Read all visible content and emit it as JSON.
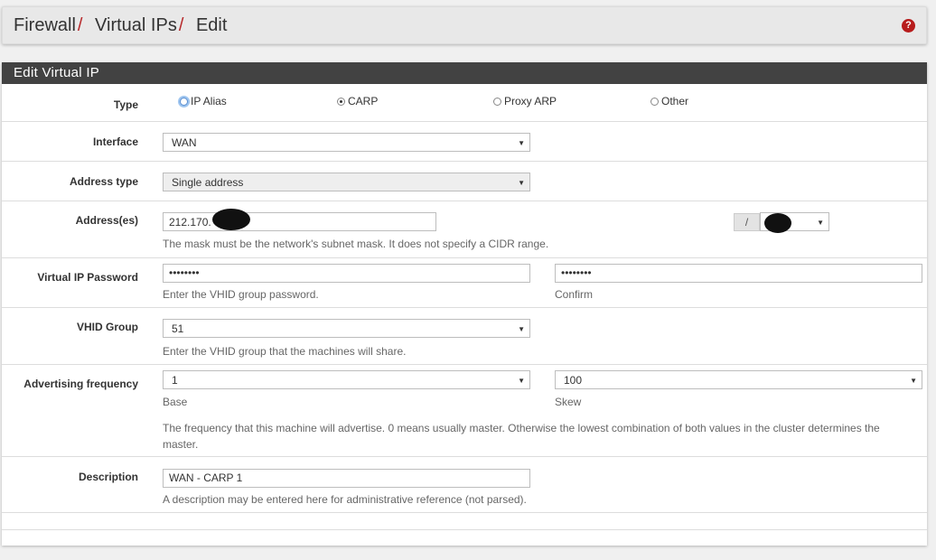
{
  "breadcrumb": {
    "items": [
      "Firewall",
      "Virtual IPs",
      "Edit"
    ],
    "separator": "/"
  },
  "help_icon": "?",
  "panel": {
    "title": "Edit Virtual IP"
  },
  "type": {
    "label": "Type",
    "options": [
      "IP Alias",
      "CARP",
      "Proxy ARP",
      "Other"
    ],
    "selected": "CARP"
  },
  "interface": {
    "label": "Interface",
    "value": "WAN"
  },
  "address_type": {
    "label": "Address type",
    "value": "Single address"
  },
  "addresses": {
    "label": "Address(es)",
    "value": "212.170.",
    "mask_separator": "/",
    "help": "The mask must be the network's subnet mask. It does not specify a CIDR range."
  },
  "password": {
    "label": "Virtual IP Password",
    "value": "••••••••",
    "confirm_value": "••••••••",
    "help": "Enter the VHID group password.",
    "confirm_help": "Confirm"
  },
  "vhid": {
    "label": "VHID Group",
    "value": "51",
    "help": "Enter the VHID group that the machines will share."
  },
  "advertising": {
    "label": "Advertising frequency",
    "base_value": "1",
    "skew_value": "100",
    "base_help": "Base",
    "skew_help": "Skew",
    "help_line1": "The frequency that this machine will advertise. 0 means usually master. Otherwise the lowest combination of both values in the cluster determines the",
    "help_line2": "master."
  },
  "description": {
    "label": "Description",
    "value": "WAN - CARP 1",
    "help": "A description may be entered here for administrative reference (not parsed)."
  },
  "colors": {
    "header_bg": "#e8e8e8",
    "panel_heading_bg": "#424242",
    "accent_red": "#b7282a"
  }
}
